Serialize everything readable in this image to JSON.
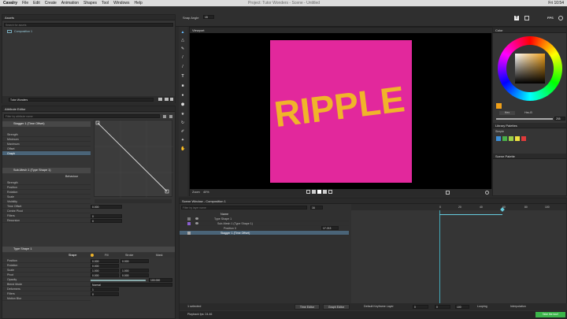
{
  "menubar": {
    "app": "Cavalry",
    "items": [
      "File",
      "Edit",
      "Create",
      "Animation",
      "Shapes",
      "Tool",
      "Windows",
      "Help"
    ],
    "window_title": "Project: Tutor Wonders - Scene - Untitled",
    "clock": "Fri 10:54"
  },
  "toolbar": {
    "snap_label": "Snap Angle",
    "snap_value": "15",
    "fps_label": "FPS"
  },
  "assets": {
    "title": "Assets",
    "search_placeholder": "Search for assets",
    "item": "Composition 1",
    "project_label": "Tutor Wonders"
  },
  "attribute_editor": {
    "title": "Attribute Editor",
    "search_placeholder": "Filter by attribute name",
    "stagger_section": "Stagger 1 (Time Offset)",
    "stagger_rows": [
      "Strength",
      "Minimum",
      "Maximum",
      "Offset",
      "Graph"
    ],
    "submesh_section": "Sub-Mesh 1 (Type Shape 1)",
    "behaviour_label": "Behaviour",
    "submesh_rows": [
      "Strength",
      "Position",
      "Rotation",
      "Scale",
      "Visibility",
      "Time Offset",
      "Centre Pivot",
      "Filters",
      "Recursion"
    ],
    "time_offset_value": "0.000",
    "filters_value": "0",
    "recursion_value": "0",
    "typeshape_section": "Type Shape 1",
    "tabs": [
      "Shape",
      "Fill",
      "Stroke",
      "Mask"
    ],
    "shape_rows": [
      "Position",
      "Rotation",
      "Scale",
      "Pivot",
      "Opacity",
      "Blend Mode",
      "Deformers",
      "Filters",
      "Motion Blur"
    ],
    "position_x": "0.000",
    "position_y": "0.000",
    "rotation_value": "0.000",
    "scale_x": "1.000",
    "scale_y": "1.000",
    "pivot_x": "0.000",
    "pivot_y": "0.000",
    "opacity_value": "100.000",
    "blend_value": "Normal",
    "deformers_value": "1",
    "filters2_value": "0"
  },
  "viewport": {
    "tab": "Viewport",
    "artwork_text": "RIPPLE",
    "zoom_label": "Zoom",
    "zoom_value": "40%",
    "bg_color": "#e2289c",
    "text_color": "#f0b42a"
  },
  "scene": {
    "title": "Scene Window - Composition 1",
    "search_placeholder": "Filter by layer name",
    "frame_field": "16",
    "name_header": "Name",
    "layers": [
      "Type Shape 1",
      "Sub-Mesh 1 (Type Shape 1)",
      "Position X",
      "Stagger 1 (Time Offset)"
    ],
    "position_value": "17.213",
    "ruler": [
      "0",
      "20",
      "40",
      "60",
      "80",
      "100"
    ],
    "selected": "1 selected",
    "time_editor": "Time Editor",
    "graph_editor": "Graph Editor",
    "keyframe_layer": "Default Keyframe Layer",
    "frame_start": "0",
    "frame_current": "0",
    "frame_end": "100",
    "looping": "Looping",
    "interpolation": "Interpolation",
    "playback": "Playback fps: 24.46",
    "take_tour": "Take the tour!"
  },
  "color_panel": {
    "title": "Color",
    "hex_label": "Hex",
    "hsv_label": "Hsv-B",
    "slider_value": "255",
    "swatch_color": "#f0a018",
    "library_title": "Library Palettes",
    "library_name": "Simple",
    "palette": [
      "#3d8fd6",
      "#4ab04a",
      "#9bd04a",
      "#f0e040",
      "#e03a3a"
    ],
    "scene_palette_title": "Scene Palette"
  }
}
